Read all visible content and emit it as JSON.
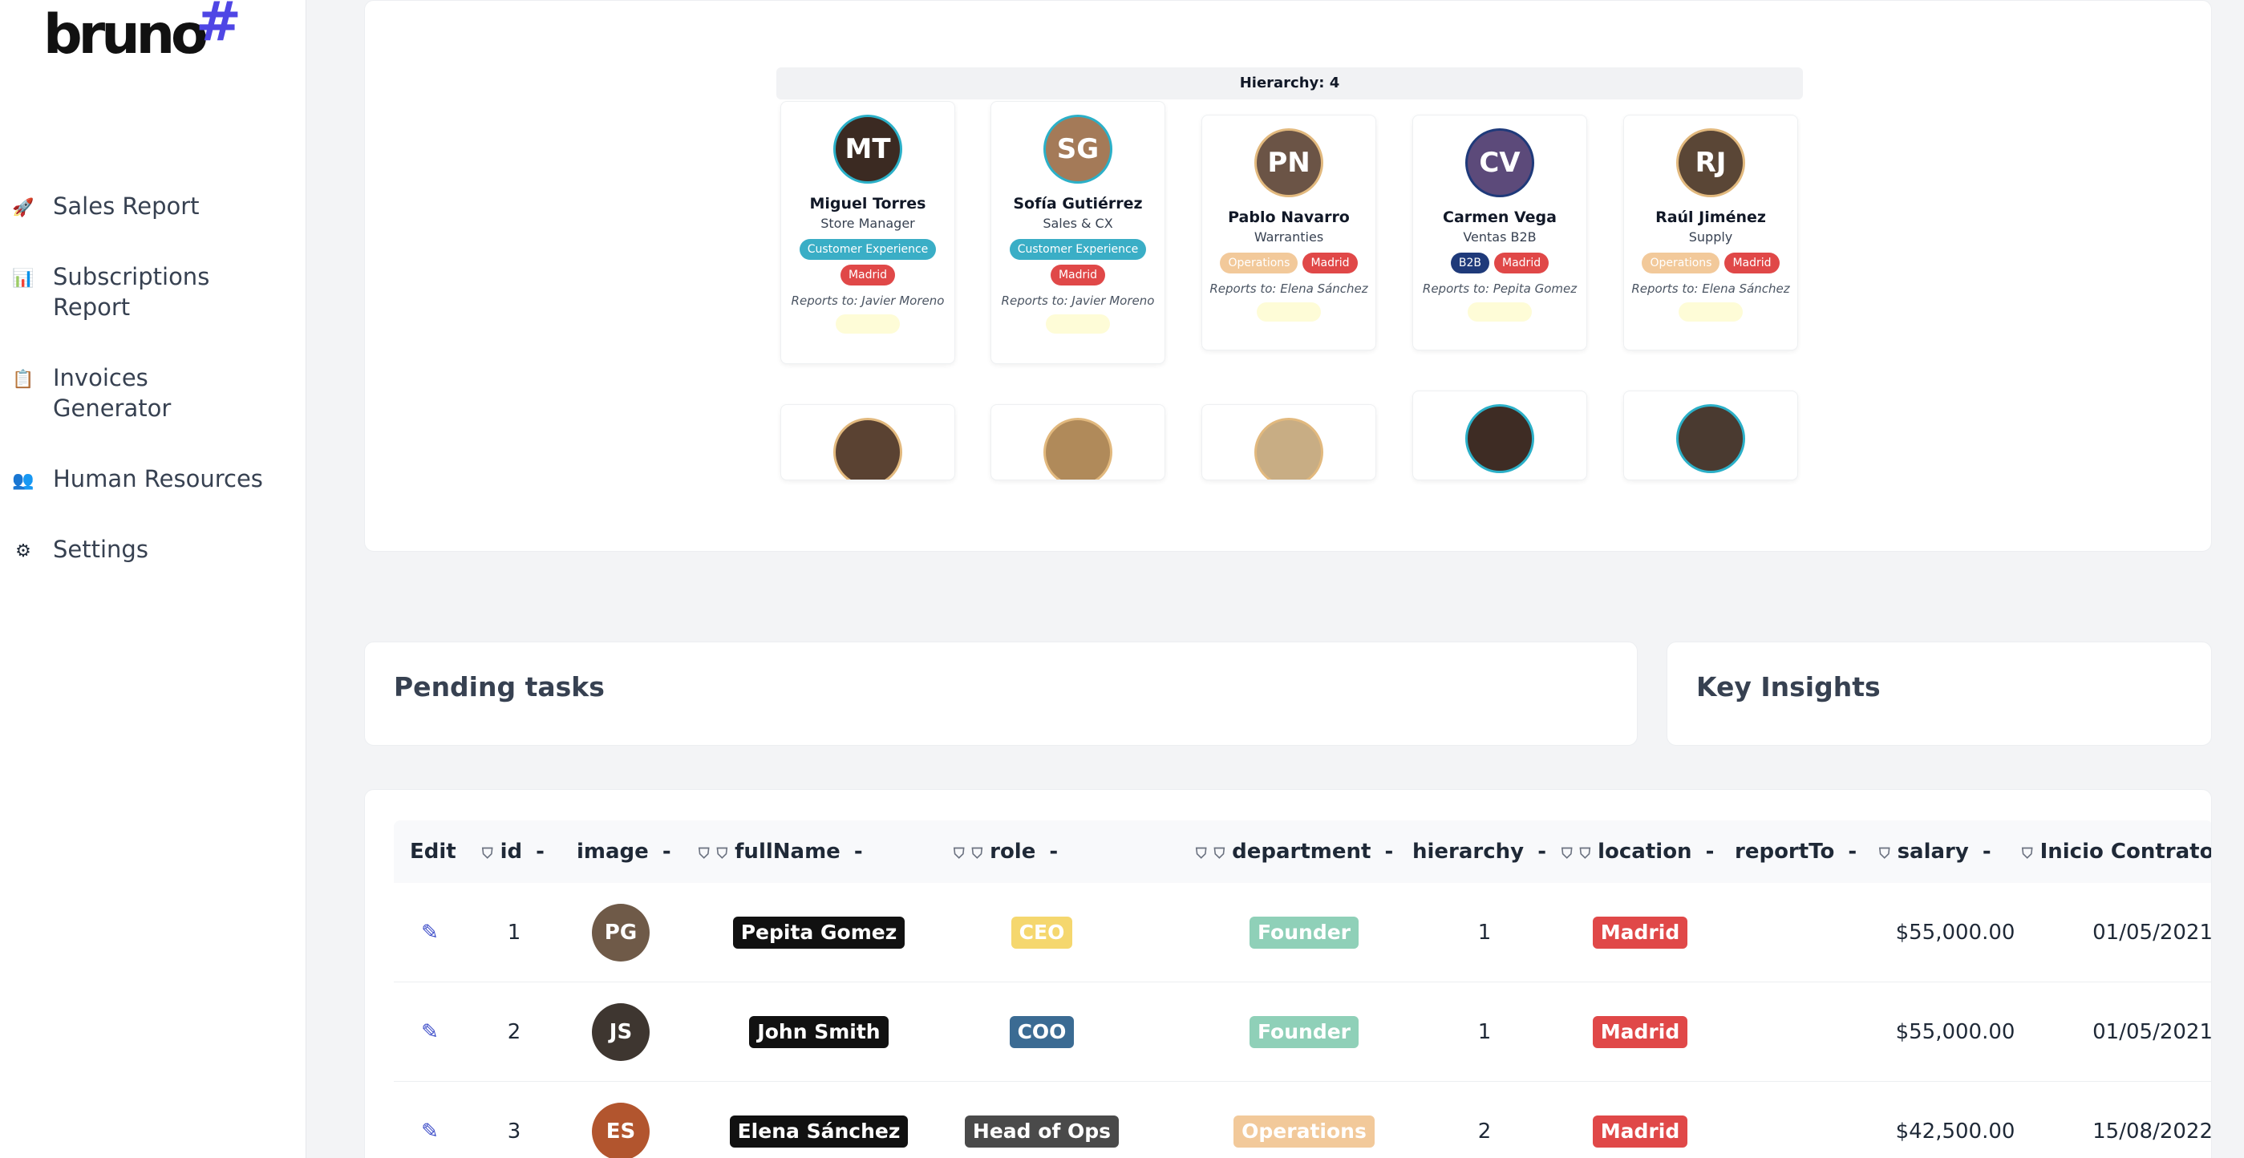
{
  "brand": {
    "name": "bruno",
    "mark": "#"
  },
  "sidebar": {
    "items": [
      {
        "label": "Sales Report",
        "icon": "rocket-icon",
        "glyph": "🚀"
      },
      {
        "label": "Subscriptions Report",
        "icon": "bar-chart-icon",
        "glyph": "📊"
      },
      {
        "label": "Invoices Generator",
        "icon": "clipboard-icon",
        "glyph": "📋"
      },
      {
        "label": "Human Resources",
        "icon": "people-icon",
        "glyph": "👥"
      },
      {
        "label": "Settings",
        "icon": "gear-icon",
        "glyph": "⚙"
      }
    ]
  },
  "org": {
    "hierarchy_label": "Hierarchy: 4",
    "people": [
      {
        "name": "Miguel Torres",
        "role": "Store Manager",
        "tags": [
          {
            "text": "Customer Experience",
            "color": "#3aaec6"
          },
          {
            "text": "Madrid",
            "color": "#e04848"
          }
        ],
        "reports": "Reports to: Javier Moreno",
        "initials": "MT",
        "bg": "#3b2a22"
      },
      {
        "name": "Sofía Gutiérrez",
        "role": "Sales & CX",
        "tags": [
          {
            "text": "Customer Experience",
            "color": "#3aaec6"
          },
          {
            "text": "Madrid",
            "color": "#e04848"
          }
        ],
        "reports": "Reports to: Javier Moreno",
        "initials": "SG",
        "bg": "#a47a58"
      },
      {
        "name": "Pablo Navarro",
        "role": "Warranties",
        "tags": [
          {
            "text": "Operations",
            "color": "#f2c99a"
          },
          {
            "text": "Madrid",
            "color": "#e04848"
          }
        ],
        "reports": "Reports to: Elena Sánchez",
        "initials": "PN",
        "bg": "#6b5446"
      },
      {
        "name": "Carmen Vega",
        "role": "Ventas B2B",
        "tags": [
          {
            "text": "B2B",
            "color": "#1f3a7a"
          },
          {
            "text": "Madrid",
            "color": "#e04848"
          }
        ],
        "reports": "Reports to: Pepita Gomez",
        "initials": "CV",
        "bg": "#5c4a7a"
      },
      {
        "name": "Raúl Jiménez",
        "role": "Supply",
        "tags": [
          {
            "text": "Operations",
            "color": "#f2c99a"
          },
          {
            "text": "Madrid",
            "color": "#e04848"
          }
        ],
        "reports": "Reports to: Elena Sánchez",
        "initials": "RJ",
        "bg": "#5a4636"
      }
    ]
  },
  "pending": {
    "title": "Pending tasks"
  },
  "insights": {
    "title": "Key Insights"
  },
  "table": {
    "headers": [
      {
        "label": "Edit",
        "shields": 0
      },
      {
        "label": "id",
        "shields": 1
      },
      {
        "label": "image",
        "shields": 0
      },
      {
        "label": "fullName",
        "shields": 2
      },
      {
        "label": "role",
        "shields": 2
      },
      {
        "label": "department",
        "shields": 2
      },
      {
        "label": "hierarchy",
        "shields": 0
      },
      {
        "label": "location",
        "shields": 2
      },
      {
        "label": "reportTo",
        "shields": 0
      },
      {
        "label": "salary",
        "shields": 1
      },
      {
        "label": "Inicio Contrato Ac",
        "shields": 1
      }
    ],
    "sort_mark": "-",
    "shield_glyph": "⛉",
    "rows": [
      {
        "id": "1",
        "fullName": "Pepita Gomez",
        "role": "CEO",
        "role_color": "#f5d76e",
        "department": "Founder",
        "dept_color": "#8fd0b8",
        "hierarchy": "1",
        "location": "Madrid",
        "reportTo": "",
        "salary": "$55,000.00",
        "start": "01/05/2021",
        "initials": "PG",
        "bg": "#6f5a48"
      },
      {
        "id": "2",
        "fullName": "John Smith",
        "role": "COO",
        "role_color": "#3b6b93",
        "department": "Founder",
        "dept_color": "#8fd0b8",
        "hierarchy": "1",
        "location": "Madrid",
        "reportTo": "",
        "salary": "$55,000.00",
        "start": "01/05/2021",
        "initials": "JS",
        "bg": "#3e3630"
      },
      {
        "id": "3",
        "fullName": "Elena Sánchez",
        "role": "Head of Ops",
        "role_color": "#4a4a4a",
        "department": "Operations",
        "dept_color": "#f2c99a",
        "hierarchy": "2",
        "location": "Madrid",
        "reportTo": "",
        "salary": "$42,500.00",
        "start": "15/08/2022",
        "initials": "ES",
        "bg": "#b2552e"
      }
    ],
    "location_color": "#e04848"
  }
}
